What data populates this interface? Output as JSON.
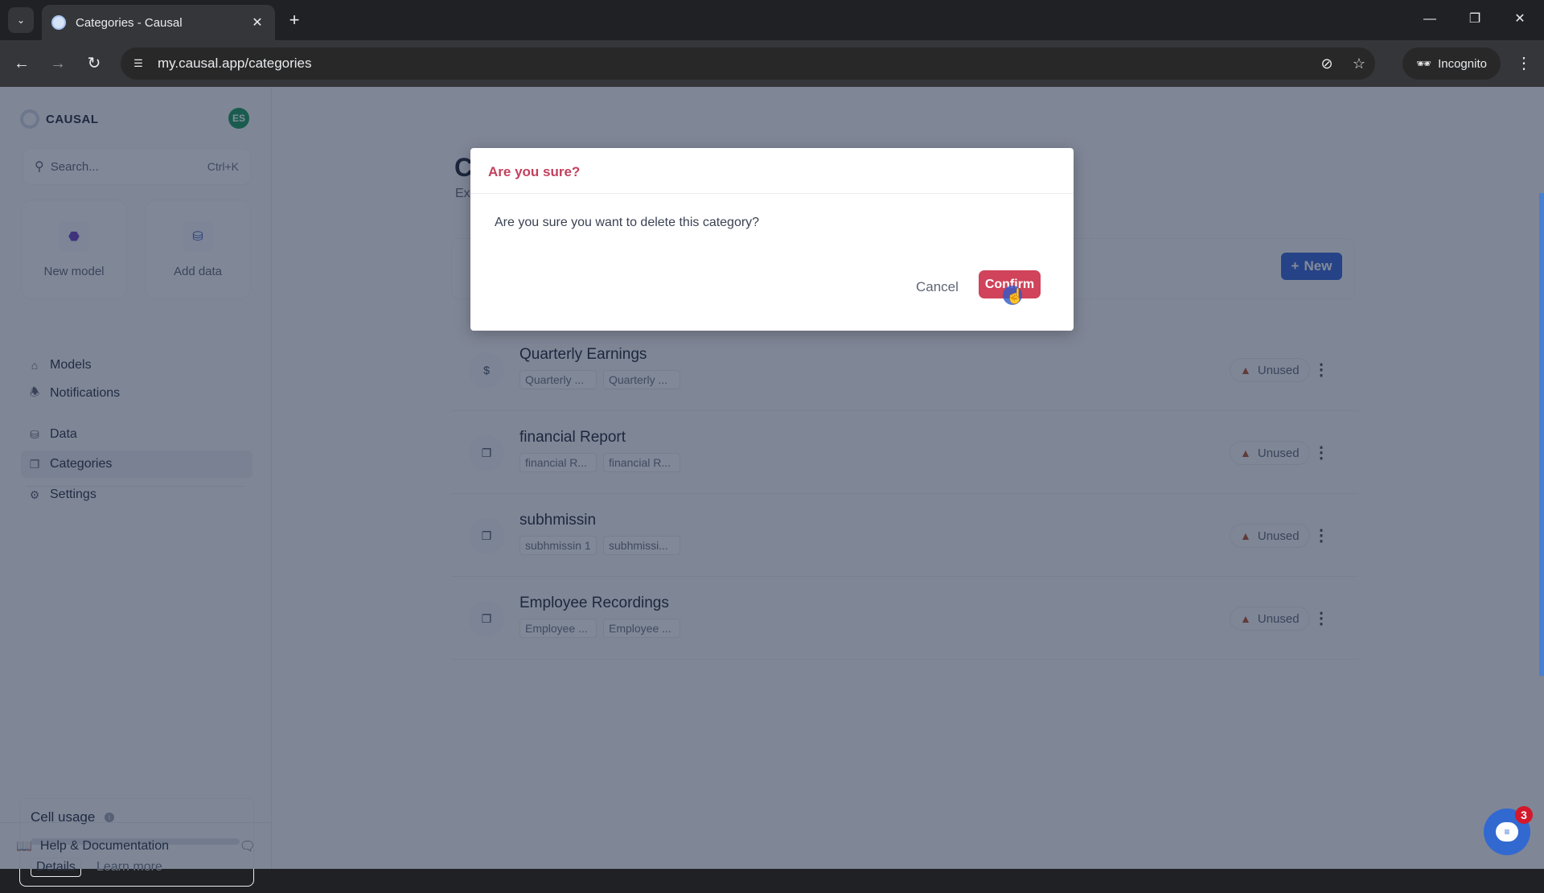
{
  "browser": {
    "tab_title": "Categories - Causal",
    "url": "my.causal.app/categories",
    "incognito_label": "Incognito",
    "icons": {
      "tab_list": "chevron-down-icon",
      "tab_close": "close-icon",
      "new_tab": "plus-icon",
      "back": "arrow-left-icon",
      "forward": "arrow-right-icon",
      "reload": "reload-icon",
      "site_info": "tune-icon",
      "eye_off": "eye-off-icon",
      "bookmark": "star-icon",
      "menu": "more-vert-icon",
      "minimize": "minimize-icon",
      "restore": "restore-icon",
      "close_window": "close-icon"
    }
  },
  "sidebar": {
    "brand": "CAUSAL",
    "avatar_initials": "ES",
    "search_placeholder": "Search...",
    "search_shortcut": "Ctrl+K",
    "quick_actions": [
      {
        "label": "New model",
        "icon": "cube-icon"
      },
      {
        "label": "Add data",
        "icon": "database-icon"
      }
    ],
    "nav": [
      {
        "label": "Models",
        "icon": "home-icon"
      },
      {
        "label": "Notifications",
        "icon": "bell-icon"
      },
      {
        "label": "Data",
        "icon": "database-icon"
      },
      {
        "label": "Categories",
        "icon": "categories-icon",
        "active": true
      },
      {
        "label": "Settings",
        "icon": "gear-icon"
      }
    ],
    "cell_usage": {
      "title": "Cell usage",
      "progress": 0,
      "details_label": "Details",
      "learn_more_label": "Learn more"
    },
    "help_label": "Help & Documentation"
  },
  "main": {
    "title_partial": "C",
    "subtitle_partial": "Ex",
    "new_button_label": "New",
    "categories": [
      {
        "name": "Quarterly Earnings",
        "icon": "dollar-icon",
        "tags": [
          "Quarterly ...",
          "Quarterly ..."
        ],
        "status": "Unused"
      },
      {
        "name": "financial Report",
        "icon": "categories-icon",
        "tags": [
          "financial R...",
          "financial R..."
        ],
        "status": "Unused"
      },
      {
        "name": "subhmissin",
        "icon": "categories-icon",
        "tags": [
          "subhmissin 1",
          "subhmissi..."
        ],
        "status": "Unused"
      },
      {
        "name": "Employee Recordings",
        "icon": "categories-icon",
        "tags": [
          "Employee ...",
          "Employee ..."
        ],
        "status": "Unused"
      }
    ]
  },
  "modal": {
    "title": "Are you sure?",
    "message": "Are you sure you want to delete this category?",
    "cancel_label": "Cancel",
    "confirm_label": "Confirm"
  },
  "chat_widget": {
    "badge_count": "3"
  },
  "colors": {
    "accent": "#2f63d6",
    "danger": "#d0435a",
    "modal_title": "#c2415d",
    "avatar": "#169a5a"
  }
}
